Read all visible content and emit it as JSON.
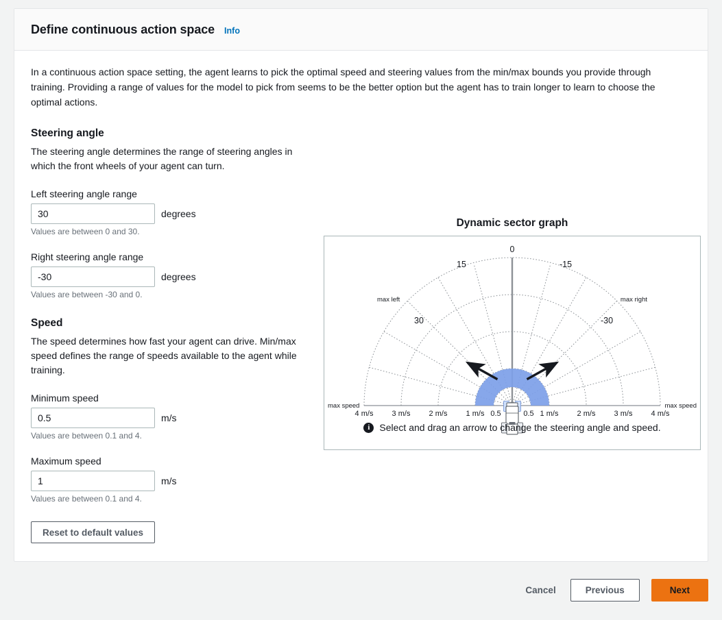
{
  "header": {
    "title": "Define continuous action space",
    "info_label": "Info"
  },
  "intro": "In a continuous action space setting, the agent learns to pick the optimal speed and steering values from the min/max bounds you provide through training. Providing a range of values for the model to pick from seems to be the better option but the agent has to train longer to learn to choose the optimal actions.",
  "steering": {
    "section_title": "Steering angle",
    "description": "The steering angle determines the range of steering angles in which the front wheels of your agent can turn.",
    "left_label": "Left steering angle range",
    "left_value": "30",
    "left_unit": "degrees",
    "left_hint": "Values are between 0 and 30.",
    "right_label": "Right steering angle range",
    "right_value": "-30",
    "right_unit": "degrees",
    "right_hint": "Values are between -30 and 0."
  },
  "speed": {
    "section_title": "Speed",
    "description": "The speed determines how fast your agent can drive. Min/max speed defines the range of speeds available to the agent while training.",
    "min_label": "Minimum speed",
    "min_value": "0.5",
    "min_unit": "m/s",
    "min_hint": "Values are between 0.1 and 4.",
    "max_label": "Maximum speed",
    "max_value": "1",
    "max_unit": "m/s",
    "max_hint": "Values are between 0.1 and 4."
  },
  "reset_button": "Reset to default values",
  "graph": {
    "title": "Dynamic sector graph",
    "note": "Select and drag an arrow to change the steering angle and speed.",
    "note_icon": "info-circle-icon",
    "angle_labels": [
      "0",
      "15",
      "-15",
      "30",
      "-30"
    ],
    "max_left_label": "max left",
    "max_right_label": "max right",
    "max_speed_label": "max speed",
    "speed_ticks": [
      "4 m/s",
      "3 m/s",
      "2 m/s",
      "1 m/s",
      "0.5"
    ],
    "sector_fill": "#7d9fe8",
    "vehicle_icon": "car-top-view-icon"
  },
  "chart_data": {
    "type": "polar-sector",
    "title": "Dynamic sector graph",
    "angle_unit": "degrees",
    "radius_unit": "m/s",
    "angle_ticks": [
      30,
      15,
      0,
      -15,
      -30
    ],
    "angle_tick_labels": [
      "30",
      "15",
      "0",
      "-15",
      "-30"
    ],
    "radius_ticks": [
      0.5,
      1,
      2,
      3,
      4
    ],
    "radius_tick_labels": [
      "0.5",
      "1 m/s",
      "2 m/s",
      "3 m/s",
      "4 m/s"
    ],
    "angle_range": [
      -30,
      30
    ],
    "radius_range": [
      0,
      4
    ],
    "selected_sector": {
      "angle_min": -30,
      "angle_max": 30,
      "speed_min": 0.5,
      "speed_max": 1,
      "fill": "#7d9fe8"
    },
    "annotations": [
      "max left",
      "max right",
      "max speed",
      "max speed"
    ],
    "grid": true,
    "legend": false
  },
  "footer": {
    "cancel": "Cancel",
    "previous": "Previous",
    "next": "Next"
  }
}
